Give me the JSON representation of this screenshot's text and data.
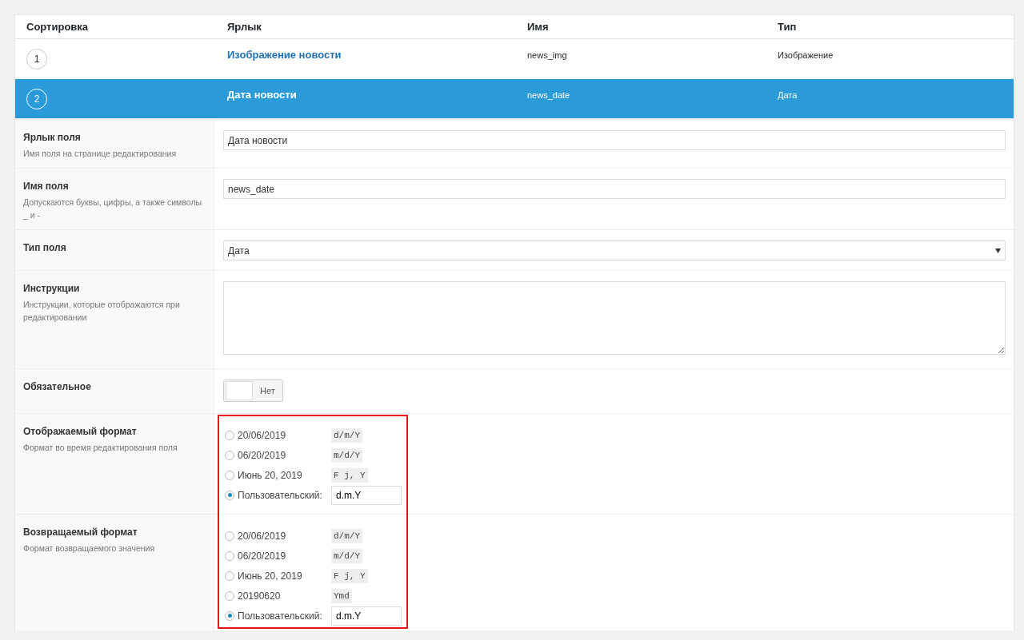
{
  "table": {
    "columns": [
      "Сортировка",
      "Ярлык",
      "Имя",
      "Тип"
    ],
    "rows": [
      {
        "order": "1",
        "label": "Изображение новости",
        "name": "news_img",
        "type": "Изображение",
        "selected": false
      },
      {
        "order": "2",
        "label": "Дата новости",
        "name": "news_date",
        "type": "Дата",
        "selected": true
      }
    ]
  },
  "settings": [
    {
      "kind": "text",
      "label": "Ярлык поля",
      "hint": "Имя поля на странице редактирования",
      "value": "Дата новости"
    },
    {
      "kind": "text",
      "label": "Имя поля",
      "hint": "Допускаются буквы, цифры, а также символы _ и -",
      "value": "news_date"
    },
    {
      "kind": "select",
      "label": "Тип поля",
      "value": "Дата"
    },
    {
      "kind": "textarea",
      "label": "Инструкции",
      "hint": "Инструкции, которые отображаются при редактировании"
    },
    {
      "kind": "toggle",
      "label": "Обязательное",
      "on": false,
      "state_label": "Нет"
    },
    {
      "kind": "radio",
      "label": "Отображаемый формат",
      "hint": "Формат во время редактирования поля",
      "options": [
        {
          "kind": "preset",
          "label": "20/06/2019",
          "code": "d/m/Y",
          "selected": false
        },
        {
          "kind": "preset",
          "label": "06/20/2019",
          "code": "m/d/Y",
          "selected": false
        },
        {
          "kind": "preset",
          "label": "Июнь 20, 2019",
          "code": "F j, Y",
          "selected": false
        },
        {
          "kind": "custom",
          "label": "Пользовательский:",
          "value": "d.m.Y",
          "selected": true
        }
      ]
    },
    {
      "kind": "radio",
      "label": "Возвращаемый формат",
      "hint": "Формат возвращаемого значения",
      "options": [
        {
          "kind": "preset",
          "label": "20/06/2019",
          "code": "d/m/Y",
          "selected": false
        },
        {
          "kind": "preset",
          "label": "06/20/2019",
          "code": "m/d/Y",
          "selected": false
        },
        {
          "kind": "preset",
          "label": "Июнь 20, 2019",
          "code": "F j, Y",
          "selected": false
        },
        {
          "kind": "preset",
          "label": "20190620",
          "code": "Ymd",
          "selected": false
        },
        {
          "kind": "custom",
          "label": "Пользовательский:",
          "value": "d.m.Y",
          "selected": true
        }
      ]
    }
  ]
}
